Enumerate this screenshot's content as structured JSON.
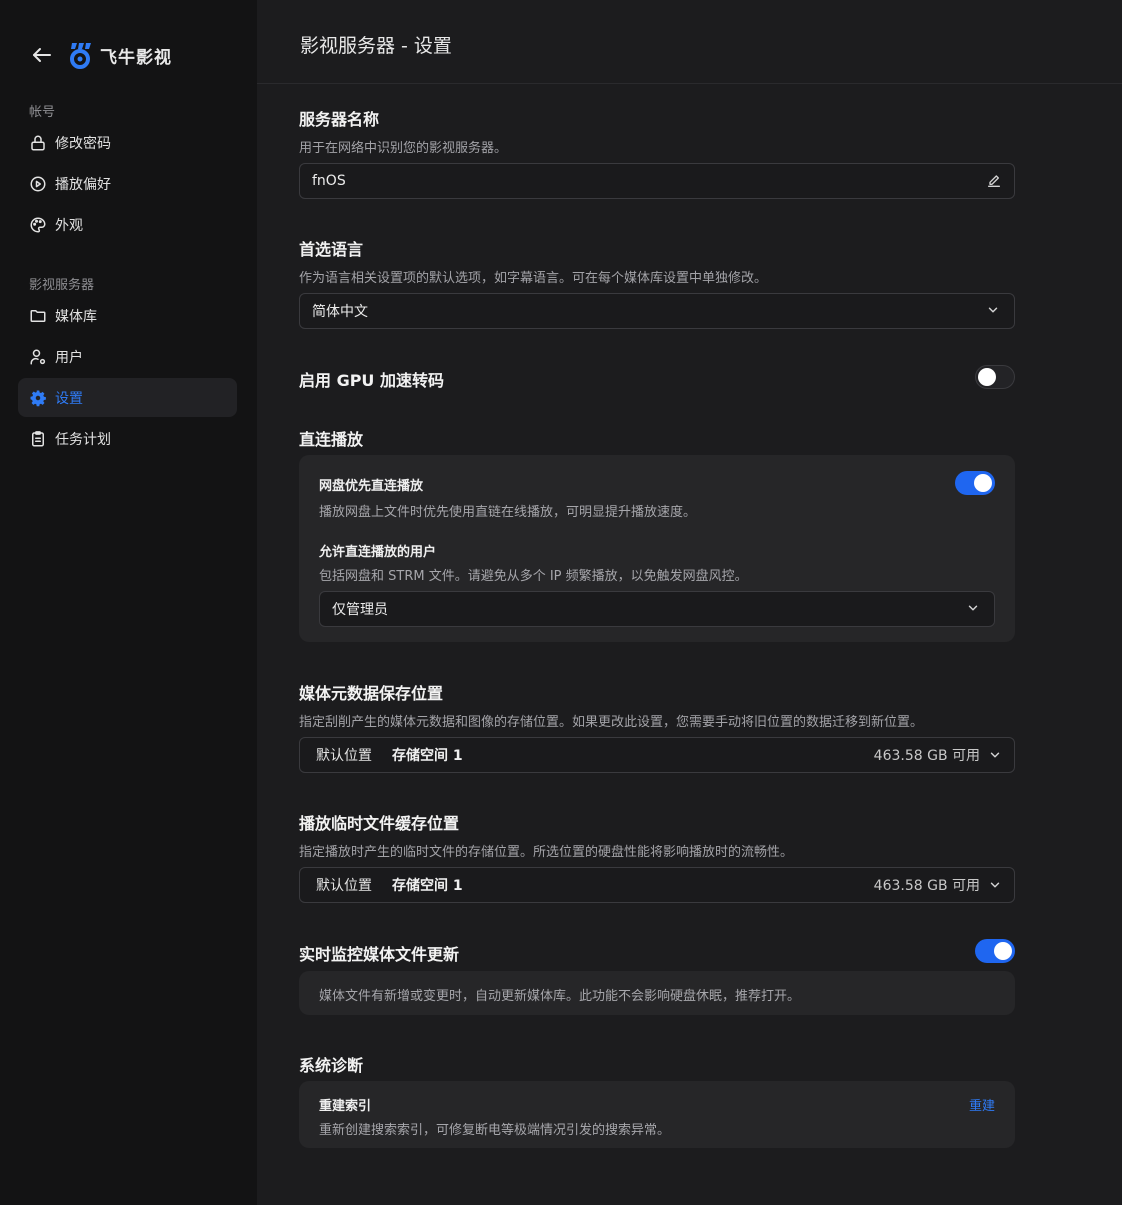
{
  "app": {
    "name": "飞牛影视"
  },
  "sidebar": {
    "sections": [
      {
        "label": "帐号",
        "items": [
          {
            "label": "修改密码",
            "icon": "lock-icon"
          },
          {
            "label": "播放偏好",
            "icon": "play-circle-icon"
          },
          {
            "label": "外观",
            "icon": "palette-icon"
          }
        ]
      },
      {
        "label": "影视服务器",
        "items": [
          {
            "label": "媒体库",
            "icon": "folder-icon"
          },
          {
            "label": "用户",
            "icon": "user-gear-icon"
          },
          {
            "label": "设置",
            "icon": "gear-icon",
            "active": true
          },
          {
            "label": "任务计划",
            "icon": "clipboard-icon"
          }
        ]
      }
    ]
  },
  "header": {
    "title": "影视服务器 - 设置"
  },
  "settings": {
    "server_name": {
      "title": "服务器名称",
      "desc": "用于在网络中识别您的影视服务器。",
      "value": "fnOS"
    },
    "language": {
      "title": "首选语言",
      "desc": "作为语言相关设置项的默认选项，如字幕语言。可在每个媒体库设置中单独修改。",
      "value": "简体中文"
    },
    "gpu": {
      "title": "启用 GPU 加速转码",
      "enabled": false
    },
    "direct_play": {
      "title": "直连播放",
      "cloud_first": {
        "title": "网盘优先直连播放",
        "desc": "播放网盘上文件时优先使用直链在线播放，可明显提升播放速度。",
        "enabled": true
      },
      "allowed_users": {
        "title": "允许直连播放的用户",
        "desc": "包括网盘和 STRM 文件。请避免从多个 IP 频繁播放，以免触发网盘风控。",
        "value": "仅管理员"
      }
    },
    "metadata_location": {
      "title": "媒体元数据保存位置",
      "desc": "指定刮削产生的媒体元数据和图像的存储位置。如果更改此设置，您需要手动将旧位置的数据迁移到新位置。",
      "location": "默认位置",
      "storage": "存储空间 1",
      "free": "463.58 GB 可用"
    },
    "cache_location": {
      "title": "播放临时文件缓存位置",
      "desc": "指定播放时产生的临时文件的存储位置。所选位置的硬盘性能将影响播放时的流畅性。",
      "location": "默认位置",
      "storage": "存储空间 1",
      "free": "463.58 GB 可用"
    },
    "realtime_monitor": {
      "title": "实时监控媒体文件更新",
      "desc": "媒体文件有新增或变更时，自动更新媒体库。此功能不会影响硬盘休眠，推荐打开。",
      "enabled": true
    },
    "diagnostics": {
      "title": "系统诊断",
      "rebuild": {
        "title": "重建索引",
        "desc": "重新创建搜索索引，可修复断电等极端情况引发的搜索异常。",
        "action": "重建"
      }
    }
  },
  "colors": {
    "accent": "#1f66f0",
    "link": "#2f7bf5",
    "sidebar_bg": "#131314",
    "main_bg": "#1c1c1e"
  }
}
